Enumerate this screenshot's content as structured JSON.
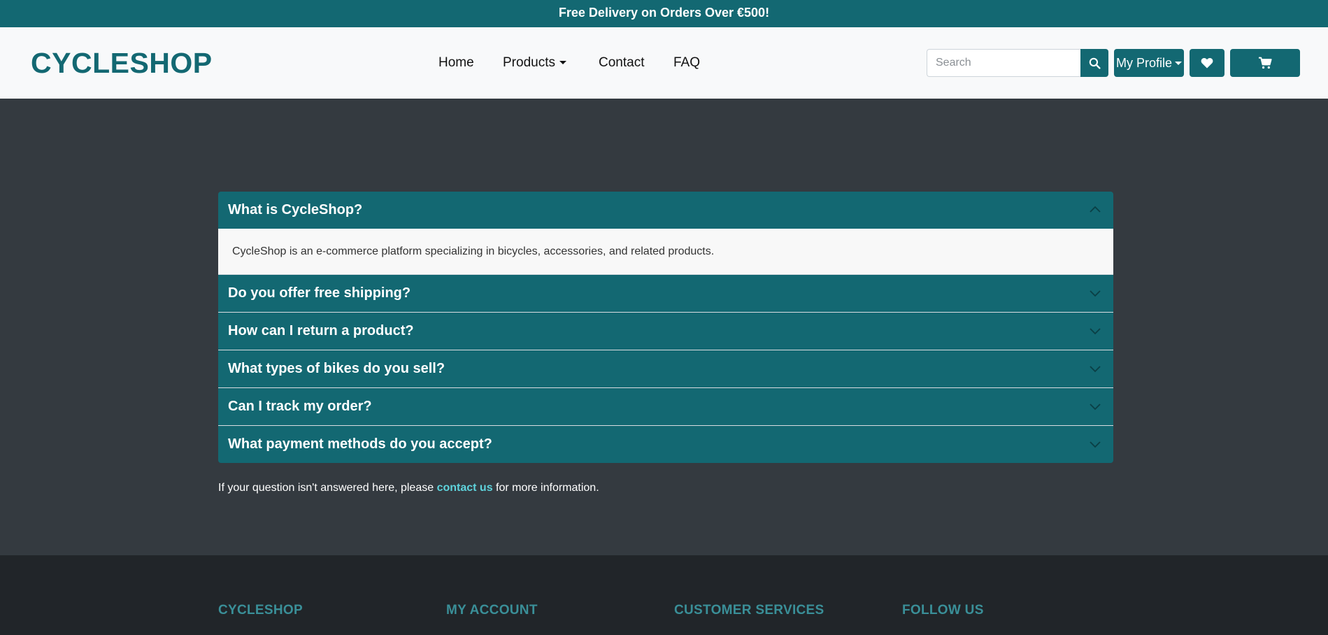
{
  "promo": {
    "text": "Free Delivery on Orders Over €500!"
  },
  "header": {
    "brand": "CYCLESHOP",
    "nav": {
      "home": "Home",
      "products": "Products",
      "contact": "Contact",
      "faq": "FAQ"
    },
    "search": {
      "placeholder": "Search",
      "icon": "search-icon"
    },
    "profile_label": "My Profile",
    "wishlist_icon": "heart-icon",
    "cart_icon": "cart-icon"
  },
  "faq": {
    "items": [
      {
        "question": "What is CycleShop?",
        "answer": "CycleShop is an e-commerce platform specializing in bicycles, accessories, and related products.",
        "expanded": true
      },
      {
        "question": "Do you offer free shipping?",
        "expanded": false
      },
      {
        "question": "How can I return a product?",
        "expanded": false
      },
      {
        "question": "What types of bikes do you sell?",
        "expanded": false
      },
      {
        "question": "Can I track my order?",
        "expanded": false
      },
      {
        "question": "What payment methods do you accept?",
        "expanded": false
      }
    ],
    "note_prefix": "If your question isn't answered here, please ",
    "note_link": "contact us",
    "note_suffix": " for more information."
  },
  "footer": {
    "columns": [
      "CYCLESHOP",
      "MY ACCOUNT",
      "CUSTOMER SERVICES",
      "FOLLOW US"
    ]
  },
  "colors": {
    "primary": "#136872",
    "page_bg": "#343a40",
    "footer_bg": "#212529",
    "link": "#5ed3dc"
  }
}
